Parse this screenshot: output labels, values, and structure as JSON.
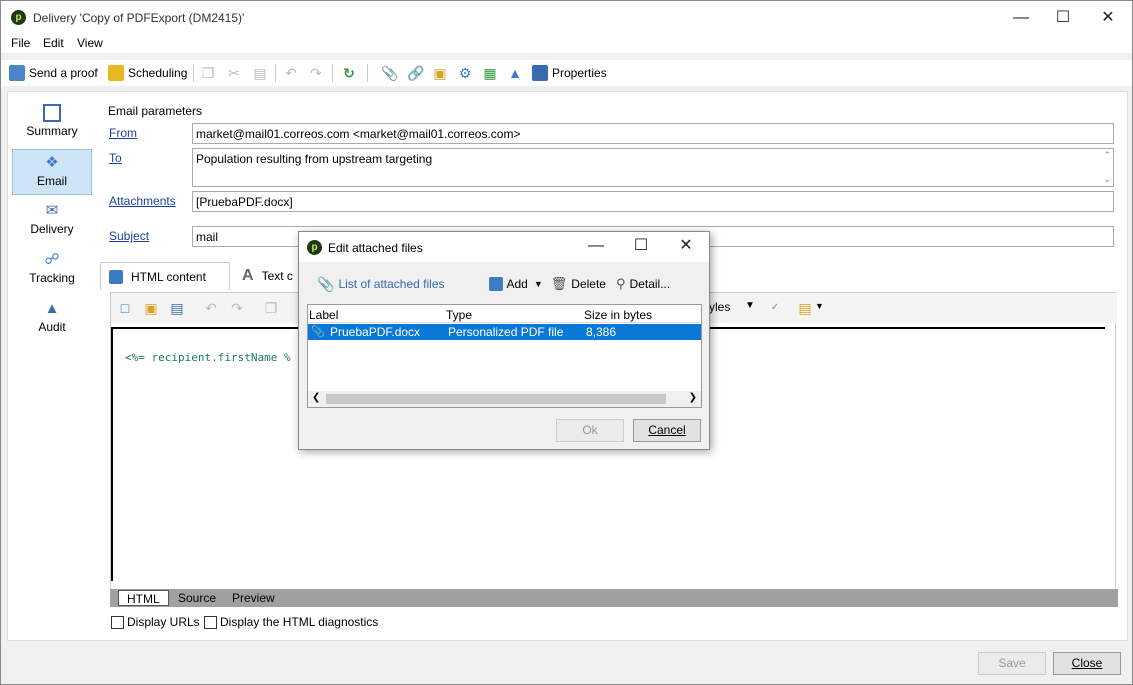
{
  "window": {
    "title": "Delivery 'Copy of PDFExport (DM2415)'",
    "app_icon": "p"
  },
  "menu": [
    "File",
    "Edit",
    "View"
  ],
  "toolbar": {
    "send_proof": "Send a proof",
    "scheduling": "Scheduling",
    "properties": "Properties"
  },
  "nav": [
    {
      "label": "Summary",
      "icon": "summary-icon"
    },
    {
      "label": "Email",
      "icon": "email-icon",
      "active": true
    },
    {
      "label": "Delivery",
      "icon": "delivery-icon"
    },
    {
      "label": "Tracking",
      "icon": "tracking-icon"
    },
    {
      "label": "Audit",
      "icon": "audit-icon"
    }
  ],
  "email": {
    "group_label": "Email parameters",
    "from_label": "From",
    "from_value": "market@mail01.correos.com <market@mail01.correos.com>",
    "to_label": "To",
    "to_value": "Population resulting from upstream targeting",
    "attachments_label": "Attachments",
    "attachments_value": "[PruebaPDF.docx]",
    "subject_label": "Subject",
    "subject_value": "mail"
  },
  "content_tabs": {
    "html": "HTML content",
    "text": "Text c"
  },
  "editor": {
    "code": "<%= recipient.firstName %",
    "styles_label": "yles",
    "bottom_tabs": [
      "HTML",
      "Source",
      "Preview"
    ]
  },
  "options": {
    "display_urls": "Display URLs",
    "display_diag": "Display the HTML diagnostics"
  },
  "buttons": {
    "save": "Save",
    "close": "Close"
  },
  "dialog": {
    "title": "Edit attached files",
    "list_label": "List of attached files",
    "add": "Add",
    "delete": "Delete",
    "detail": "Detail...",
    "columns": [
      "Label",
      "Type",
      "Size in bytes"
    ],
    "rows": [
      {
        "label": "PruebaPDF.docx",
        "type": "Personalized PDF file",
        "size": "8,386"
      }
    ],
    "ok": "Ok",
    "cancel": "Cancel"
  },
  "colors": {
    "selection": "#0a78d7",
    "link": "#1a3fa0",
    "nav_active": "#cde4f7"
  }
}
